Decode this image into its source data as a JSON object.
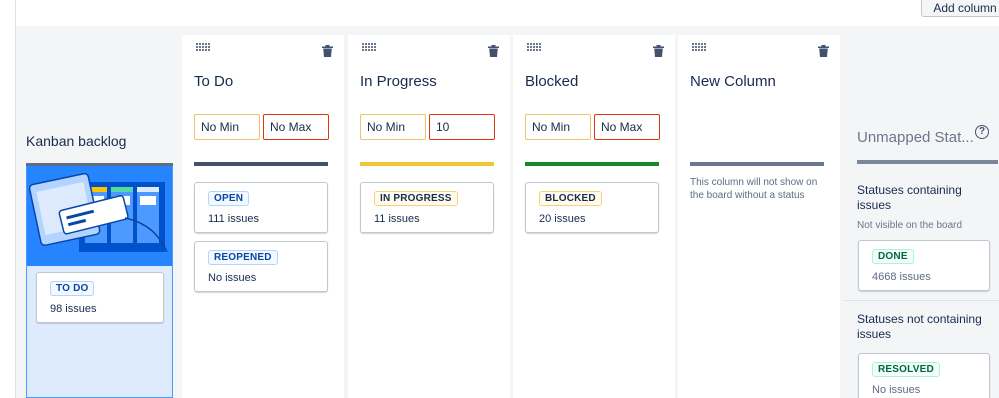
{
  "toolbar": {
    "add_column_label": "Add column"
  },
  "backlog": {
    "title": "Kanban backlog",
    "status": {
      "lozenge": "TO DO",
      "count": "98 issues"
    }
  },
  "columns": [
    {
      "name": "To Do",
      "min": "No Min",
      "max": "No Max",
      "bar_color": "#42526e",
      "statuses": [
        {
          "lozenge": "OPEN",
          "count": "111 issues"
        },
        {
          "lozenge": "REOPENED",
          "count": "No issues"
        }
      ]
    },
    {
      "name": "In Progress",
      "min": "No Min",
      "max": "10",
      "bar_color": "#f0c536",
      "statuses": [
        {
          "lozenge": "IN PROGRESS",
          "count": "11 issues"
        }
      ]
    },
    {
      "name": "Blocked",
      "min": "No Min",
      "max": "No Max",
      "bar_color": "#14892c",
      "statuses": [
        {
          "lozenge": "BLOCKED",
          "count": "20 issues"
        }
      ]
    },
    {
      "name": "New Column",
      "bar_color": "#6b778c",
      "empty_note": "This column will not show on the board without a status"
    }
  ],
  "unmapped": {
    "title": "Unmapped Stat...",
    "help_glyph": "?",
    "containing": {
      "title": "Statuses containing issues",
      "subtitle": "Not visible on the board",
      "status": {
        "lozenge": "DONE",
        "count": "4668 issues"
      }
    },
    "not_containing": {
      "title": "Statuses not containing issues",
      "status": {
        "lozenge": "RESOLVED",
        "count": "No issues"
      }
    }
  }
}
